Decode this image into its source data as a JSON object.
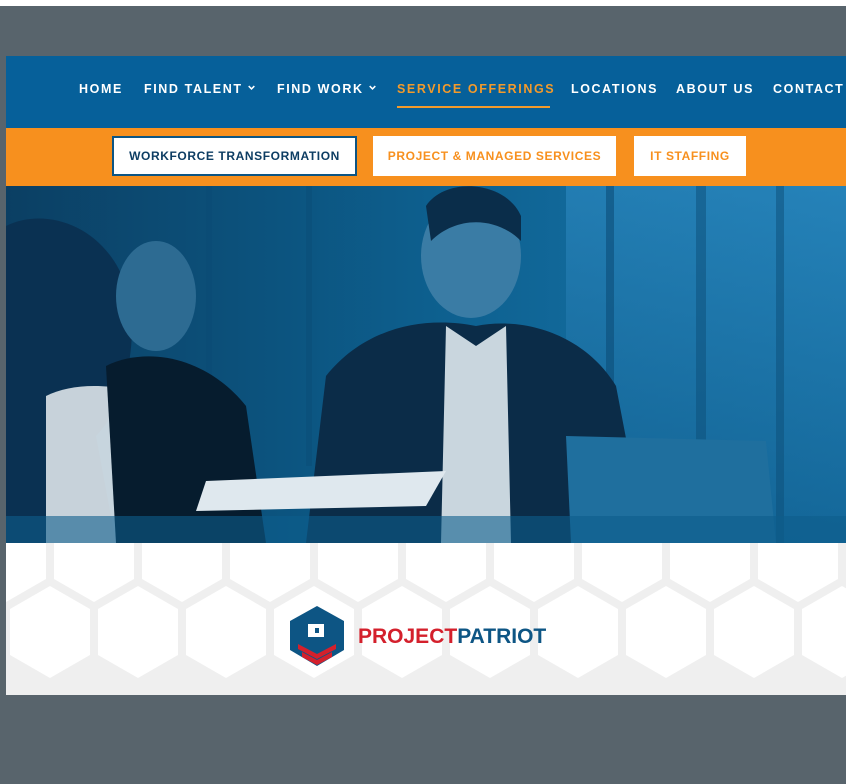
{
  "nav": {
    "items": [
      {
        "label": "HOME",
        "has_dropdown": false,
        "active": false
      },
      {
        "label": "FIND TALENT",
        "has_dropdown": true,
        "active": false
      },
      {
        "label": "FIND WORK",
        "has_dropdown": true,
        "active": false
      },
      {
        "label": "SERVICE OFFERINGS",
        "has_dropdown": false,
        "active": true
      },
      {
        "label": "LOCATIONS",
        "has_dropdown": false,
        "active": false
      },
      {
        "label": "ABOUT US",
        "has_dropdown": false,
        "active": false
      },
      {
        "label": "CONTACT U",
        "has_dropdown": false,
        "active": false
      }
    ]
  },
  "subnav": {
    "buttons": [
      {
        "label": "WORKFORCE TRANSFORMATION",
        "style": "outlined"
      },
      {
        "label": "PROJECT & MANAGED SERVICES",
        "style": "plain"
      },
      {
        "label": "IT STAFFING",
        "style": "plain"
      }
    ]
  },
  "logo": {
    "part1": "PROJECT",
    "part2": "PATRIOT"
  },
  "colors": {
    "nav_bg": "#06609a",
    "accent_orange": "#f7901e",
    "brand_blue": "#0d5584",
    "brand_red": "#d4202c",
    "frame_gray": "#58646c"
  }
}
